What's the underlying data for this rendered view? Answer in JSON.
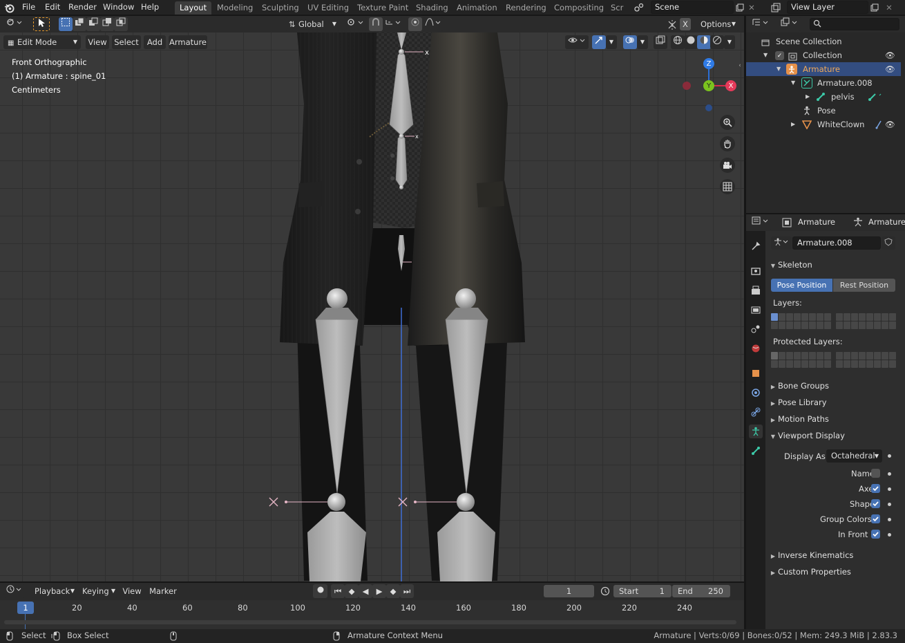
{
  "top_menu": {
    "file": "File",
    "edit": "Edit",
    "render": "Render",
    "window": "Window",
    "help": "Help"
  },
  "workspaces": [
    "Layout",
    "Modeling",
    "Sculpting",
    "UV Editing",
    "Texture Paint",
    "Shading",
    "Animation",
    "Rendering",
    "Compositing",
    "Scr"
  ],
  "scene": {
    "name": "Scene",
    "view_layer": "View Layer"
  },
  "viewport_header": {
    "orientation": "Global",
    "options": "Options",
    "mode": "Edit Mode",
    "menus": [
      "View",
      "Select",
      "Add",
      "Armature"
    ]
  },
  "overlay_info": {
    "line1": "Front Orthographic",
    "line2": "(1) Armature : spine_01",
    "line3": "Centimeters"
  },
  "gizmo": {
    "z": "Z",
    "y": "Y",
    "x": "X"
  },
  "outliner": {
    "scene_collection": "Scene Collection",
    "collection": "Collection",
    "armature": "Armature",
    "armature_data": "Armature.008",
    "pelvis": "pelvis",
    "pose": "Pose",
    "mesh": "WhiteClown"
  },
  "properties": {
    "breadcrumb1": "Armature",
    "breadcrumb2": "Armature",
    "datablock": "Armature.008",
    "skeleton": "Skeleton",
    "pose_position": "Pose Position",
    "rest_position": "Rest Position",
    "layers": "Layers:",
    "protected_layers": "Protected Layers:",
    "bone_groups": "Bone Groups",
    "pose_library": "Pose Library",
    "motion_paths": "Motion Paths",
    "viewport_display": "Viewport Display",
    "display_as_label": "Display As",
    "display_as_value": "Octahedral",
    "names": "Names",
    "axes": "Axes",
    "shapes": "Shapes",
    "group_colors": "Group Colors",
    "in_front": "In Front",
    "checks": {
      "names": false,
      "axes": true,
      "shapes": true,
      "group_colors": true,
      "in_front": true
    },
    "inverse_kinematics": "Inverse Kinematics",
    "custom_properties": "Custom Properties"
  },
  "timeline": {
    "menus": [
      "Playback",
      "Keying",
      "View",
      "Marker"
    ],
    "current_frame": "1",
    "start_label": "Start",
    "start": "1",
    "end_label": "End",
    "end": "250",
    "ruler": [
      "1",
      "20",
      "40",
      "60",
      "80",
      "100",
      "120",
      "140",
      "160",
      "180",
      "200",
      "220",
      "240"
    ]
  },
  "status": {
    "select": "Select",
    "box_select": "Box Select",
    "context_menu": "Armature Context Menu",
    "stats": "Armature | Verts:0/69 | Bones:0/52 | Mem: 249.3 MiB | 2.83.3"
  },
  "colors": {
    "accent": "#4772b3",
    "selected_row": "#334d80",
    "armature_orange": "#e6914a",
    "bone_green": "#3cc9a8"
  }
}
